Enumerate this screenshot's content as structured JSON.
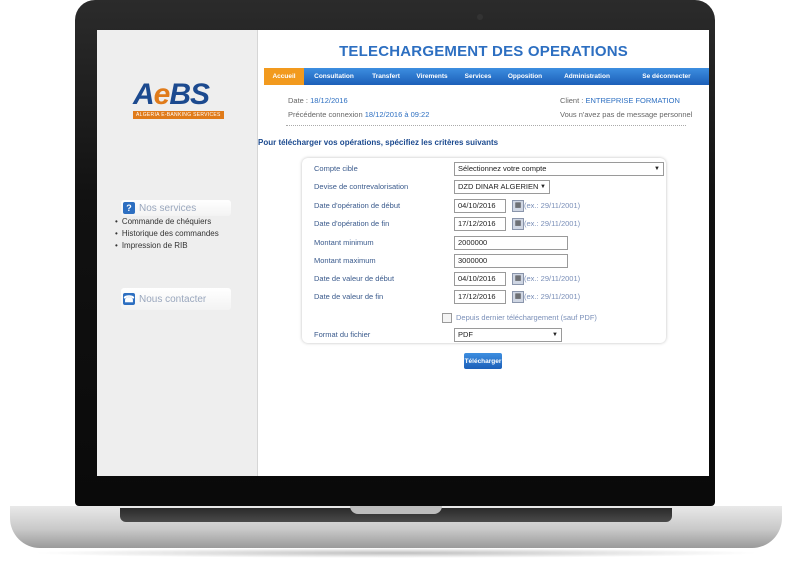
{
  "header": {
    "title": "TELECHARGEMENT DES OPERATIONS"
  },
  "brand": {
    "logo_text_a": "A",
    "logo_text_e": "e",
    "logo_text_bs": "BS",
    "logo_sub": "ALGERIA E-BANKING SERVICES",
    "primary": "#1c4a8f",
    "accent": "#e07b1a"
  },
  "nav": {
    "items": [
      "Accueil",
      "Consultation",
      "Transfert",
      "Virements",
      "Services",
      "Opposition",
      "Administration",
      "Se déconnecter"
    ],
    "active": "Accueil",
    "active_color": "#f29a1e"
  },
  "session": {
    "date_label": "Date :",
    "date_value": "18/12/2016",
    "last_conn_label": "Précédente connexion",
    "last_conn_value": "18/12/2016 à 09:22",
    "client_label": "Client :",
    "client_value": "ENTREPRISE FORMATION",
    "message": "Vous n'avez pas de message personnel"
  },
  "sidebar": {
    "services_title": "Nos services",
    "services": [
      "Commande de chéquiers",
      "Historique des commandes",
      "Impression de RIB"
    ],
    "contact_title": "Nous contacter"
  },
  "form": {
    "intro": "Pour télécharger vos opérations, spécifiez les critères suivants",
    "compte_label": "Compte cible",
    "compte_value": "Sélectionnez votre compte",
    "devise_label": "Devise de contrevalorisation",
    "devise_value": "DZD DINAR ALGERIEN",
    "op_debut_label": "Date d'opération de début",
    "op_debut_value": "04/10/2016",
    "op_fin_label": "Date d'opération de fin",
    "op_fin_value": "17/12/2016",
    "min_label": "Montant minimum",
    "min_value": "2000000",
    "max_label": "Montant maximum",
    "max_value": "3000000",
    "val_debut_label": "Date de valeur de début",
    "val_debut_value": "04/10/2016",
    "val_fin_label": "Date de valeur de fin",
    "val_fin_value": "17/12/2016",
    "example": "(ex.: 29/11/2001)",
    "depuis_label": "Depuis dernier téléchargement (sauf PDF)",
    "format_label": "Format du fichier",
    "format_value": "PDF",
    "submit": "Télécharger"
  }
}
